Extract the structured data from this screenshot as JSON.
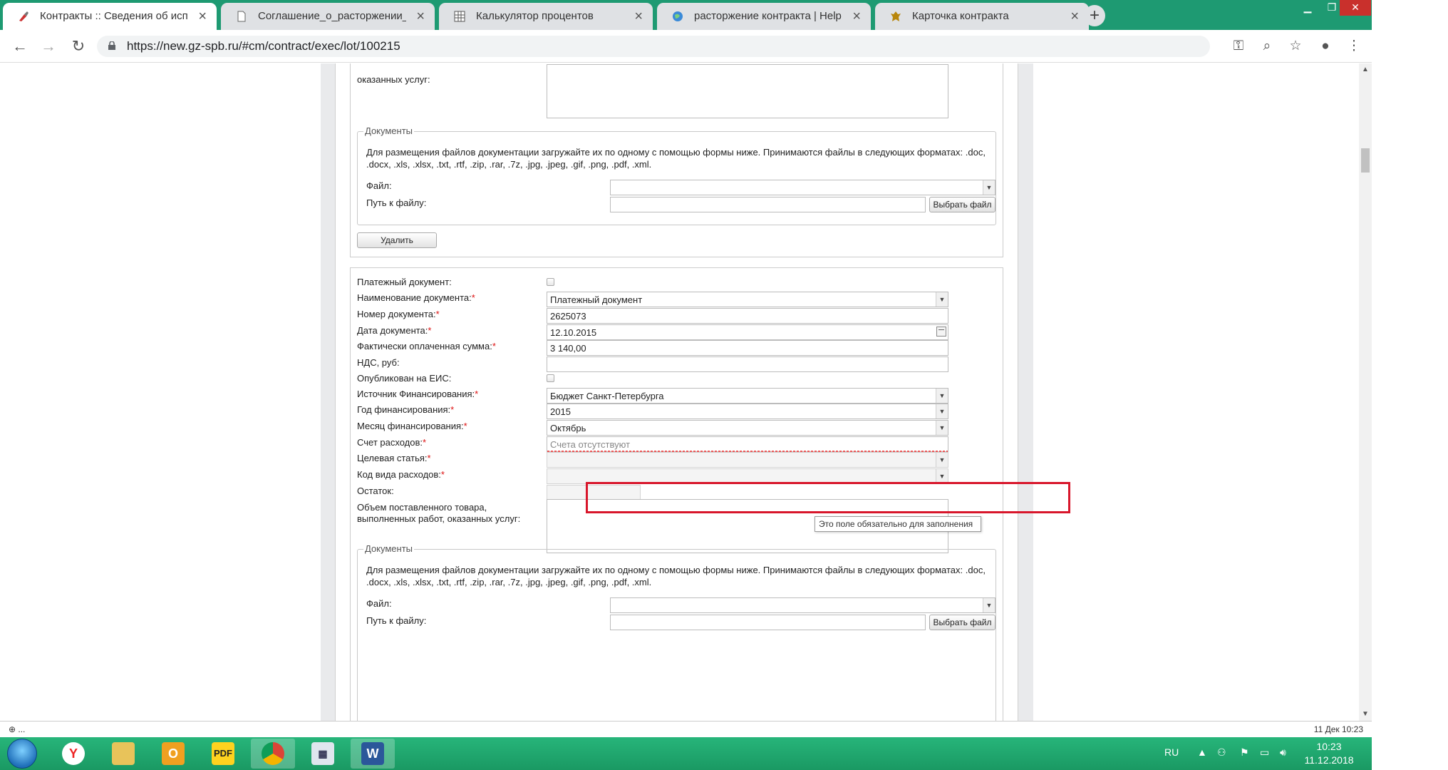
{
  "browser": {
    "tabs": [
      {
        "title": "Контракты :: Сведения об испол",
        "active": true
      },
      {
        "title": "Соглашение_о_расторжении_П",
        "active": false
      },
      {
        "title": "Калькулятор процентов",
        "active": false
      },
      {
        "title": "расторжение контракта | HelpD",
        "active": false
      },
      {
        "title": "Карточка контракта",
        "active": false
      }
    ],
    "url": "https://new.gz-spb.ru/#cm/contract/exec/lot/100215"
  },
  "top_section": {
    "textarea_label_tail": "оказанных услуг:",
    "documents": {
      "legend": "Документы",
      "description": "Для размещения файлов документации загружайте их по одному с помощью формы ниже. Принимаются файлы в следующих форматах: .doc, .docx, .xls, .xlsx, .txt, .rtf, .zip, .rar, .7z, .jpg, .jpeg, .gif, .png, .pdf, .xml.",
      "file_label": "Файл:",
      "path_label": "Путь к файлу:",
      "browse_button": "Выбрать файл"
    },
    "delete_button": "Удалить"
  },
  "payment_form": {
    "payment_document_label": "Платежный документ:",
    "document_name_label": "Наименование документа:",
    "document_name_value": "Платежный документ",
    "document_number_label": "Номер документа:",
    "document_number_value": "2625073",
    "document_date_label": "Дата документа:",
    "document_date_value": "12.10.2015",
    "paid_amount_label": "Фактически оплаченная сумма:",
    "paid_amount_value": "3 140,00",
    "vat_label": "НДС, руб:",
    "published_label": "Опубликован на ЕИС:",
    "funding_source_label": "Источник Финансирования:",
    "funding_source_value": "Бюджет Санкт-Петербурга",
    "funding_year_label": "Год финансирования:",
    "funding_year_value": "2015",
    "funding_month_label": "Месяц финансирования:",
    "funding_month_value": "Октябрь",
    "expense_account_label": "Счет расходов:",
    "expense_account_placeholder": "Счета отсутствуют",
    "target_article_label": "Целевая статья:",
    "expense_type_label": "Код вида расходов:",
    "balance_label": "Остаток:",
    "volume_label": "Объем поставленного товара, выполненных работ, оказанных услуг:",
    "required_mark": "*",
    "tooltip": "Это поле обязательно для заполнения",
    "documents": {
      "legend": "Документы",
      "description": "Для размещения файлов документации загружайте их по одному с помощью формы ниже. Принимаются файлы в следующих форматах: .doc, .docx, .xls, .xlsx, .txt, .rtf, .zip, .rar, .7z, .jpg, .jpeg, .gif, .png, .pdf, .xml.",
      "file_label": "Файл:",
      "path_label": "Путь к файлу:",
      "browse_button": "Выбрать файл"
    }
  },
  "status_bar": {
    "left": "⊕ ...",
    "right": "11 Дек 10:23"
  },
  "taskbar": {
    "lang": "RU",
    "time": "10:23",
    "date": "11.12.2018"
  },
  "colors": {
    "tabbar": "#1e9a72",
    "taskbar": "#1fa86d",
    "highlight": "#d8162b",
    "required": "#dd1111"
  }
}
